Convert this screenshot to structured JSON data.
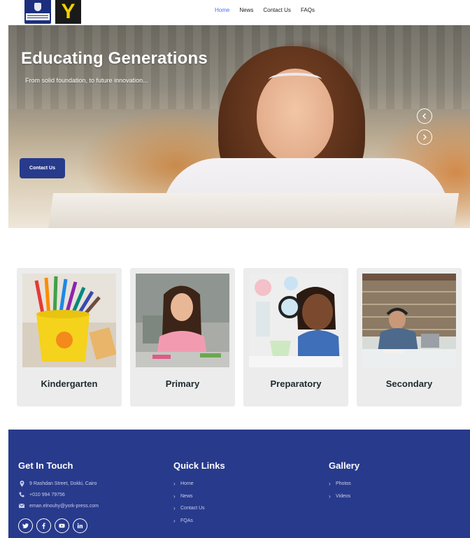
{
  "header": {
    "logo_left_alt": "school-crest-logo",
    "logo_right_text": "Y",
    "nav": [
      {
        "label": "Home",
        "active": true
      },
      {
        "label": "News",
        "active": false
      },
      {
        "label": "Contact Us",
        "active": false
      },
      {
        "label": "FAQs",
        "active": false
      }
    ]
  },
  "hero": {
    "title": "Educating Generations",
    "subtitle": "From solid foundation, to future innovation...",
    "cta_label": "Contact Us",
    "prev_icon": "chevron-left-icon",
    "next_icon": "chevron-right-icon"
  },
  "categories": [
    {
      "label": "Kindergarten",
      "image": "colored-pencils-photo"
    },
    {
      "label": "Primary",
      "image": "girl-at-desk-photo"
    },
    {
      "label": "Preparatory",
      "image": "boy-magnifier-photo"
    },
    {
      "label": "Secondary",
      "image": "student-library-photo"
    }
  ],
  "footer": {
    "contact": {
      "title": "Get In Touch",
      "address": "9 Rashdan Street, Dokki, Cairo",
      "phone": "+010 994 79756",
      "email": "eman.elnouhy@york-press.com",
      "social": [
        "twitter-icon",
        "facebook-icon",
        "youtube-icon",
        "linkedin-icon"
      ]
    },
    "quick_links": {
      "title": "Quick Links",
      "items": [
        "Home",
        "News",
        "Contact Us",
        "FQAs"
      ]
    },
    "gallery": {
      "title": "Gallery",
      "items": [
        "Photos",
        "Videos"
      ]
    }
  },
  "colors": {
    "brand_navy": "#283a8c",
    "nav_active": "#4a6cf7",
    "card_bg": "#ececec",
    "logo_yellow": "#f2d100"
  }
}
